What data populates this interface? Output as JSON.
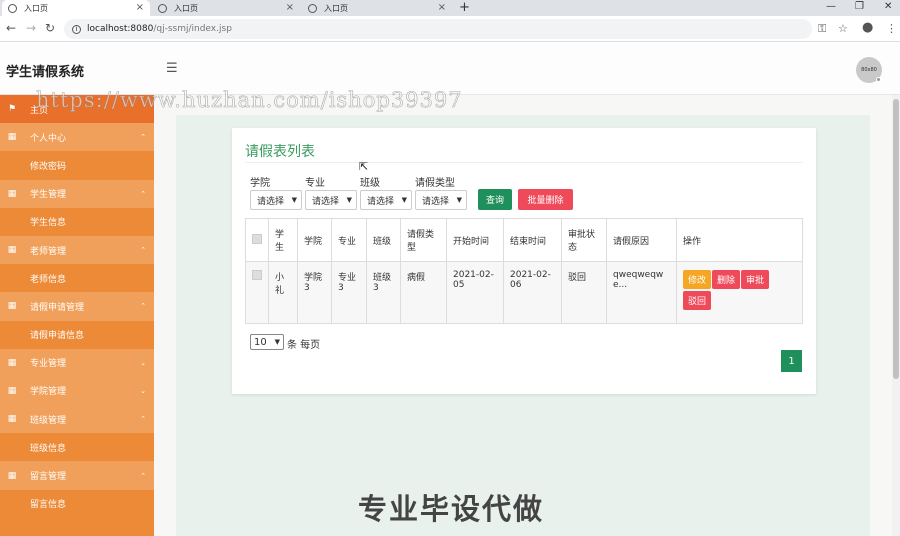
{
  "browser": {
    "tabs": [
      {
        "title": "入口页"
      },
      {
        "title": "入口页"
      },
      {
        "title": "入口页"
      }
    ],
    "url_host": "localhost:8080",
    "url_path": "/qj-ssmj/index.jsp"
  },
  "header": {
    "title": "学生请假系统",
    "avatar_text": "80x80"
  },
  "sidebar": {
    "home": "主页",
    "items": [
      {
        "label": "个人中心",
        "type": "group"
      },
      {
        "label": "修改密码",
        "type": "sub"
      },
      {
        "label": "学生管理",
        "type": "group"
      },
      {
        "label": "学生信息",
        "type": "sub"
      },
      {
        "label": "老师管理",
        "type": "group"
      },
      {
        "label": "老师信息",
        "type": "sub"
      },
      {
        "label": "请假申请管理",
        "type": "group"
      },
      {
        "label": "请假申请信息",
        "type": "sub"
      },
      {
        "label": "专业管理",
        "type": "group"
      },
      {
        "label": "学院管理",
        "type": "group"
      },
      {
        "label": "班级管理",
        "type": "group"
      },
      {
        "label": "班级信息",
        "type": "sub"
      },
      {
        "label": "留言管理",
        "type": "group"
      },
      {
        "label": "留言信息",
        "type": "sub"
      }
    ]
  },
  "main": {
    "title": "请假表列表",
    "filters": [
      {
        "label": "学院",
        "value": "请选择"
      },
      {
        "label": "专业",
        "value": "请选择"
      },
      {
        "label": "班级",
        "value": "请选择"
      },
      {
        "label": "请假类型",
        "value": "请选择"
      }
    ],
    "query_label": "查询",
    "batch_delete_label": "批量删除",
    "table": {
      "headers": [
        "学生",
        "学院",
        "专业",
        "班级",
        "请假类型",
        "开始时间",
        "结束时间",
        "审批状态",
        "请假原因",
        "操作"
      ],
      "rows": [
        {
          "student": "小礼",
          "college": "学院3",
          "major": "专业3",
          "class": "班级3",
          "type": "病假",
          "start": "2021-02-05",
          "end": "2021-02-06",
          "status": "驳回",
          "reason": "qweqweqwe..."
        }
      ],
      "actions": {
        "edit": "修改",
        "delete": "删除",
        "approve": "审批",
        "reject": "驳回"
      }
    },
    "pagination": {
      "page_size": "10",
      "per_page_text": "条 每页",
      "current_page": "1"
    }
  },
  "overlays": {
    "watermark_url": "https://www.huzhan.com/ishop39397",
    "watermark_cn": "专业毕设代做"
  },
  "colors": {
    "sidebar": "#ec8a37",
    "accent_green": "#1f8f5b",
    "danger": "#ef4a5a",
    "warning": "#f5a623"
  }
}
